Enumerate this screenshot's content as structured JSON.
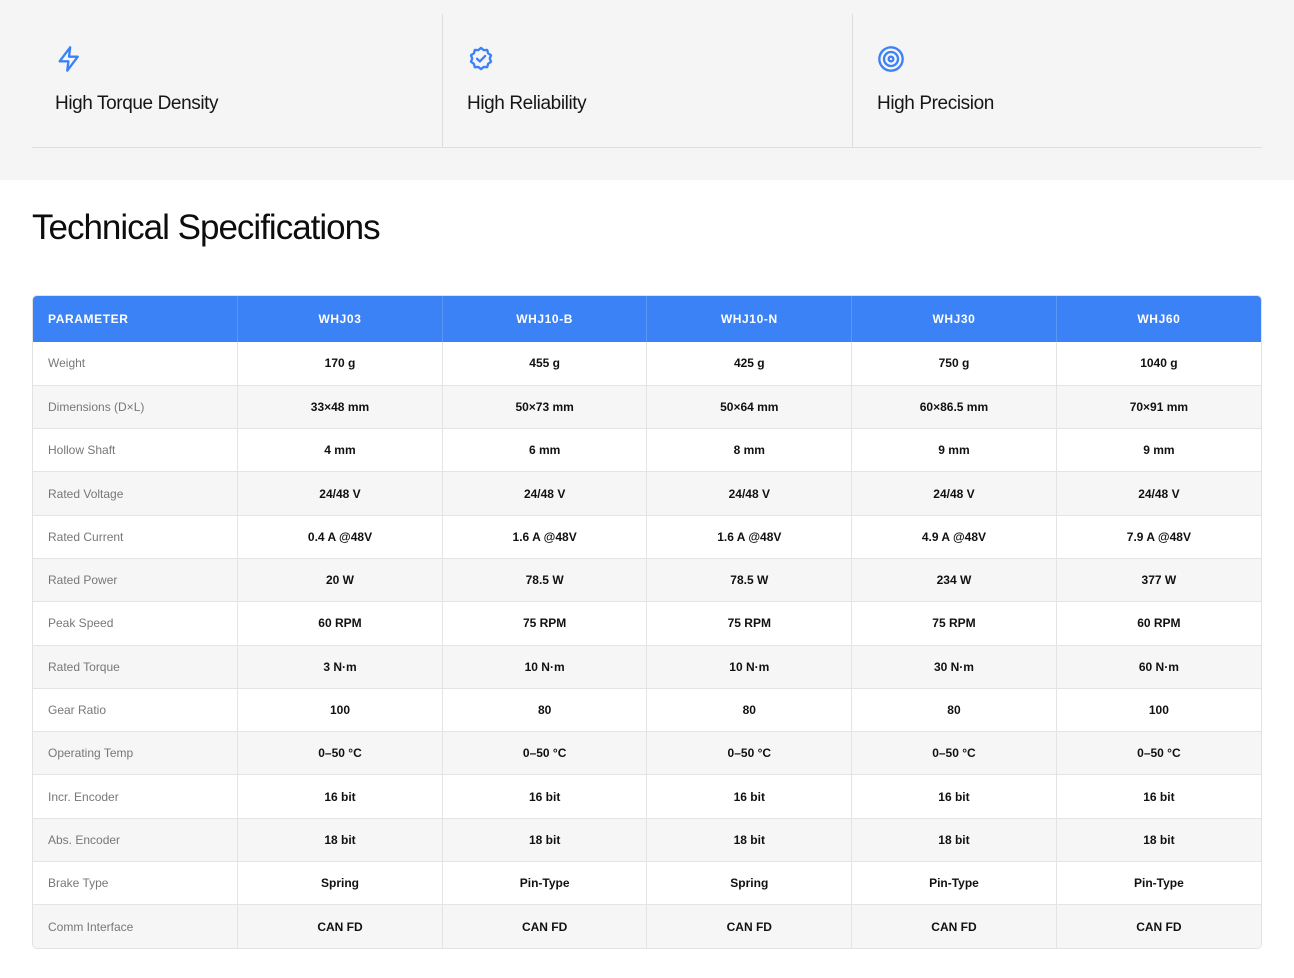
{
  "colors": {
    "accent": "#3b82f6",
    "band_background": "#f5f5f5"
  },
  "features": [
    {
      "icon": "lightning-bolt-icon",
      "title": "High Torque Density"
    },
    {
      "icon": "badge-check-icon",
      "title": "High Reliability"
    },
    {
      "icon": "target-icon",
      "title": "High Precision"
    }
  ],
  "section_title": "Technical Specifications",
  "spec_table": {
    "headers": [
      "PARAMETER",
      "WHJ03",
      "WHJ10-B",
      "WHJ10-N",
      "WHJ30",
      "WHJ60"
    ],
    "rows": [
      [
        "Weight",
        "170 g",
        "455 g",
        "425 g",
        "750 g",
        "1040 g"
      ],
      [
        "Dimensions (D×L)",
        "33×48 mm",
        "50×73 mm",
        "50×64 mm",
        "60×86.5 mm",
        "70×91 mm"
      ],
      [
        "Hollow Shaft",
        "4 mm",
        "6 mm",
        "8 mm",
        "9 mm",
        "9 mm"
      ],
      [
        "Rated Voltage",
        "24/48 V",
        "24/48 V",
        "24/48 V",
        "24/48 V",
        "24/48 V"
      ],
      [
        "Rated Current",
        "0.4 A @48V",
        "1.6 A @48V",
        "1.6 A @48V",
        "4.9 A @48V",
        "7.9 A @48V"
      ],
      [
        "Rated Power",
        "20 W",
        "78.5 W",
        "78.5 W",
        "234 W",
        "377 W"
      ],
      [
        "Peak Speed",
        "60 RPM",
        "75 RPM",
        "75 RPM",
        "75 RPM",
        "60 RPM"
      ],
      [
        "Rated Torque",
        "3 N·m",
        "10 N·m",
        "10 N·m",
        "30 N·m",
        "60 N·m"
      ],
      [
        "Gear Ratio",
        "100",
        "80",
        "80",
        "80",
        "100"
      ],
      [
        "Operating Temp",
        "0–50 °C",
        "0–50 °C",
        "0–50 °C",
        "0–50 °C",
        "0–50 °C"
      ],
      [
        "Incr. Encoder",
        "16 bit",
        "16 bit",
        "16 bit",
        "16 bit",
        "16 bit"
      ],
      [
        "Abs. Encoder",
        "18 bit",
        "18 bit",
        "18 bit",
        "18 bit",
        "18 bit"
      ],
      [
        "Brake Type",
        "Spring",
        "Pin-Type",
        "Spring",
        "Pin-Type",
        "Pin-Type"
      ],
      [
        "Comm Interface",
        "CAN FD",
        "CAN FD",
        "CAN FD",
        "CAN FD",
        "CAN FD"
      ]
    ]
  }
}
